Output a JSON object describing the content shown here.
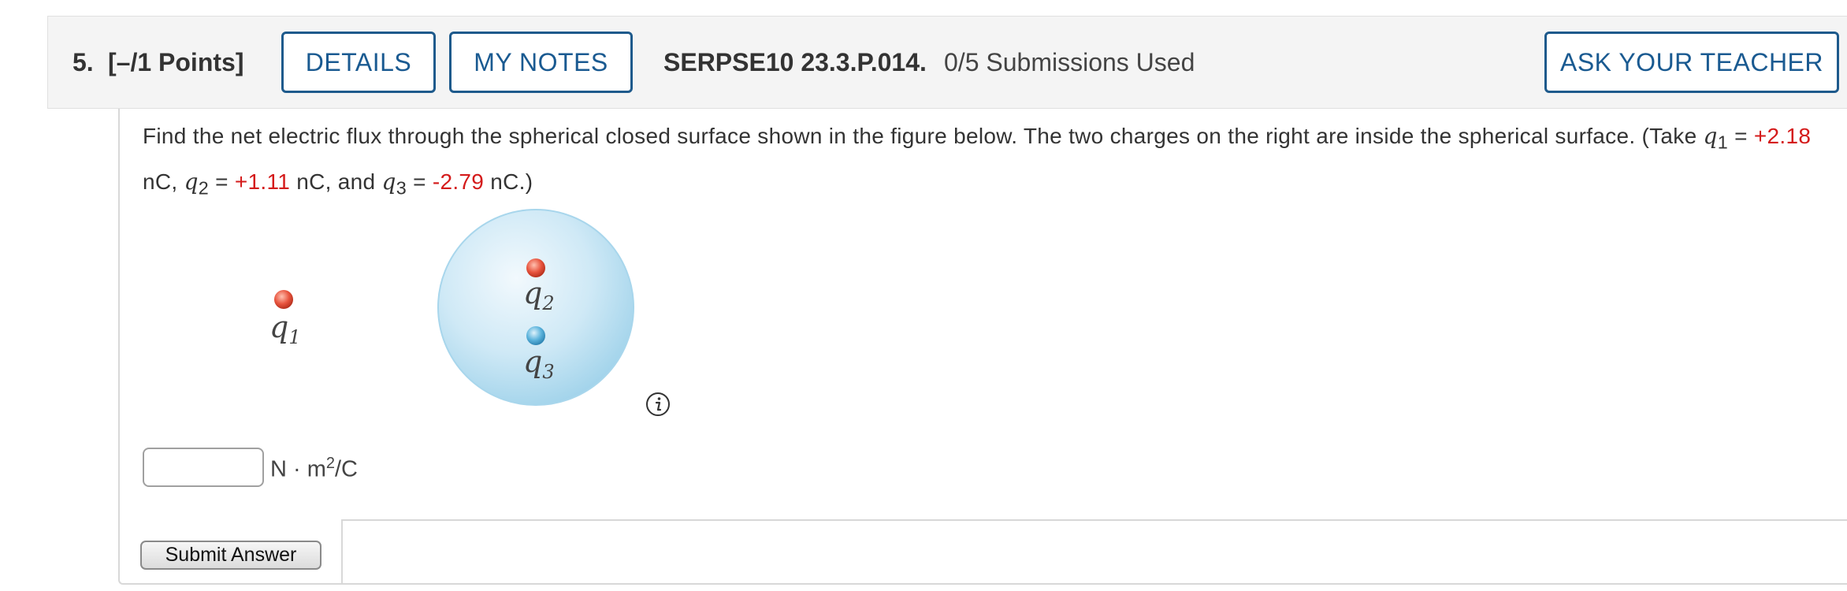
{
  "header": {
    "question_number": "5.",
    "points": "[–/1 Points]",
    "details_label": "DETAILS",
    "my_notes_label": "MY NOTES",
    "assignment_code": "SERPSE10 23.3.P.014.",
    "submissions": "0/5 Submissions Used",
    "ask_teacher_label": "ASK YOUR TEACHER"
  },
  "question": {
    "text_1": "Find the net electric flux through the spherical closed surface shown in the figure below. The two charges on the right are inside the spherical surface. (Take ",
    "q1_symbol": "q",
    "q1_sub": "1",
    "eq": " = ",
    "q1_value": "+2.18",
    "unit_nc_1": " nC, ",
    "q2_symbol": "q",
    "q2_sub": "2",
    "q2_value": "+1.11",
    "unit_nc_2": " nC, and ",
    "q3_symbol": "q",
    "q3_sub": "3",
    "q3_value": "-2.79",
    "unit_nc_3": " nC.)"
  },
  "figure": {
    "q1_label": "q",
    "q1_sub": "1",
    "q2_label": "q",
    "q2_sub": "2",
    "q3_label": "q",
    "q3_sub": "3",
    "positive_charge_color": "#e8553f",
    "negative_charge_color": "#5bb3dc",
    "sphere_color": "#bfe3f3"
  },
  "answer": {
    "input_value": "",
    "unit_base": "N · m",
    "unit_exp": "2",
    "unit_tail": "/C",
    "submit_label": "Submit Answer"
  },
  "icons": {
    "info": "info-icon"
  }
}
